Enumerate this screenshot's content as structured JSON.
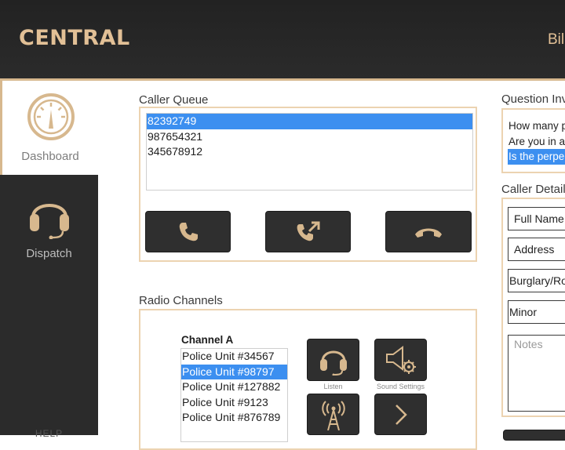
{
  "header": {
    "brand": "CENTRAL",
    "user_partial": "Bil"
  },
  "sidebar": {
    "items": [
      {
        "label": "Dashboard",
        "icon": "gauge-icon",
        "active": true
      },
      {
        "label": "Dispatch",
        "icon": "headset-icon",
        "active": false
      }
    ],
    "bottom_partial": "HELP"
  },
  "caller_queue": {
    "title": "Caller Queue",
    "items": [
      "82392749",
      "987654321",
      "345678912"
    ],
    "selected_index": 0,
    "buttons": [
      {
        "name": "answer-call-button",
        "icon": "phone-icon"
      },
      {
        "name": "transfer-call-button",
        "icon": "phone-forward-icon"
      },
      {
        "name": "hang-up-button",
        "icon": "phone-hangup-icon"
      }
    ]
  },
  "radio_channels": {
    "title": "Radio Channels",
    "channel_title": "Channel A",
    "units": [
      "Police Unit #34567",
      "Police Unit #98797",
      "Police Unit #127882",
      "Police Unit #9123",
      "Police Unit #876789"
    ],
    "selected_index": 1,
    "controls": [
      {
        "label": "Listen",
        "icon": "headset-icon"
      },
      {
        "label": "Sound Settings",
        "icon": "speaker-gear-icon"
      },
      {
        "label": "",
        "icon": "radio-tower-icon"
      },
      {
        "label": "",
        "icon": "chevron-right-icon"
      }
    ]
  },
  "questions": {
    "title_partial": "Question Inv",
    "items": [
      "How many p",
      "Are you in a",
      "Is the perpe"
    ],
    "selected_index": 2
  },
  "caller_details": {
    "title_partial": "Caller Detail",
    "fields": [
      "Full Name",
      "Address",
      "Burglary/Ro",
      "Minor"
    ],
    "notes_placeholder": "Notes"
  },
  "colors": {
    "accent": "#d7b88e",
    "dark": "#2b2b2b",
    "selection": "#3c8ff0"
  }
}
